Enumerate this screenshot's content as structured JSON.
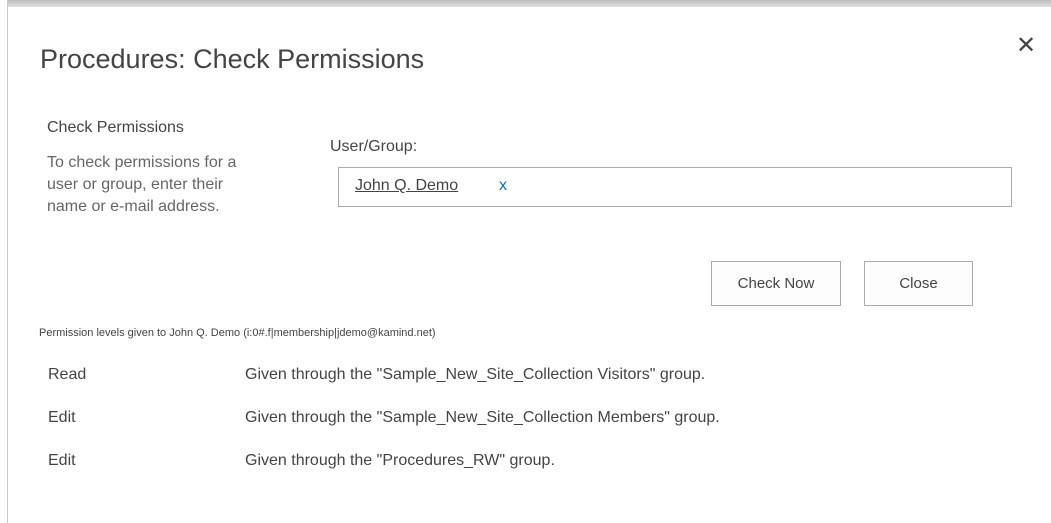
{
  "dialog": {
    "title": "Procedures: Check Permissions",
    "close_icon": "close-icon"
  },
  "section": {
    "heading": "Check Permissions",
    "description_lines": [
      "To check permissions for a",
      "user or group, enter their",
      "name or e-mail address."
    ]
  },
  "user_group": {
    "label": "User/Group:",
    "resolved_name": "John Q. Demo",
    "remove_label": "x"
  },
  "buttons": {
    "check_now": "Check Now",
    "close": "Close"
  },
  "results": {
    "caption": "Permission levels given to John Q. Demo (i:0#.f|membership|jdemo@kamind.net)",
    "rows": [
      {
        "level": "Read",
        "source": "Given through the \"Sample_New_Site_Collection Visitors\" group."
      },
      {
        "level": "Edit",
        "source": "Given through the \"Sample_New_Site_Collection Members\" group."
      },
      {
        "level": "Edit",
        "source": "Given through the \"Procedures_RW\" group."
      }
    ]
  }
}
